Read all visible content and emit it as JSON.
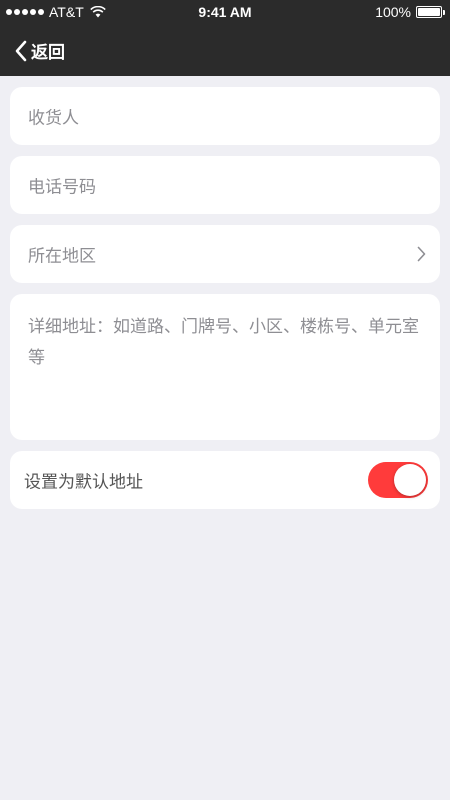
{
  "status_bar": {
    "carrier": "AT&T",
    "time": "9:41 AM",
    "battery": "100%"
  },
  "nav": {
    "back_label": "返回"
  },
  "form": {
    "consignee_placeholder": "收货人",
    "phone_placeholder": "电话号码",
    "region_placeholder": "所在地区",
    "address_placeholder": "详细地址：如道路、门牌号、小区、楼栋号、单元室等",
    "default_label": "设置为默认地址",
    "default_on": true
  },
  "colors": {
    "nav_background": "#2b2b2b",
    "page_background": "#efeff4",
    "toggle_on": "#ff3b3b",
    "placeholder_text": "#8e8e93"
  },
  "icons": [
    "signal-icon",
    "wifi-icon",
    "battery-icon",
    "back-chevron-icon",
    "chevron-right-icon"
  ]
}
